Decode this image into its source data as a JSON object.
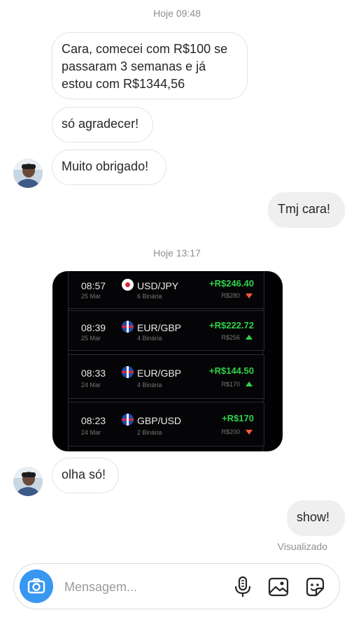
{
  "chat": {
    "timestamp_1": "Hoje 09:48",
    "timestamp_2": "Hoje 13:17",
    "messages": [
      {
        "side": "incoming",
        "text": "Cara, comecei com R$100 se passaram 3 semanas e já estou com R$1344,56"
      },
      {
        "side": "incoming",
        "text": "só agradecer!"
      },
      {
        "side": "incoming",
        "text": "Muito obrigado!"
      },
      {
        "side": "outgoing",
        "text": "Tmj cara!"
      },
      {
        "side": "incoming",
        "text": "olha só!"
      },
      {
        "side": "outgoing",
        "text": "show!"
      }
    ],
    "seen_label": "Visualizado"
  },
  "trades": [
    {
      "time": "08:57",
      "date": "25 Mar",
      "pair": "USD/JPY",
      "type": "6 Binária",
      "profit": "+R$246.40",
      "stake": "R$280",
      "direction": "down"
    },
    {
      "time": "08:39",
      "date": "25 Mar",
      "pair": "EUR/GBP",
      "type": "4 Binária",
      "profit": "+R$222.72",
      "stake": "R$256",
      "direction": "up"
    },
    {
      "time": "08:33",
      "date": "24 Mar",
      "pair": "EUR/GBP",
      "type": "4 Binária",
      "profit": "+R$144.50",
      "stake": "R$170",
      "direction": "up"
    },
    {
      "time": "08:23",
      "date": "24 Mar",
      "pair": "GBP/USD",
      "type": "2 Binária",
      "profit": "+R$170",
      "stake": "R$200",
      "direction": "down"
    }
  ],
  "composer": {
    "placeholder": "Mensagem...",
    "icons": [
      "camera-icon",
      "microphone-icon",
      "gallery-icon",
      "sticker-icon"
    ]
  },
  "colors": {
    "accent": "#3897f0",
    "profit": "#2fd34a",
    "arrow_up": "#2fd34a",
    "arrow_down": "#ff5a36",
    "outgoing_bubble": "#efefef"
  }
}
